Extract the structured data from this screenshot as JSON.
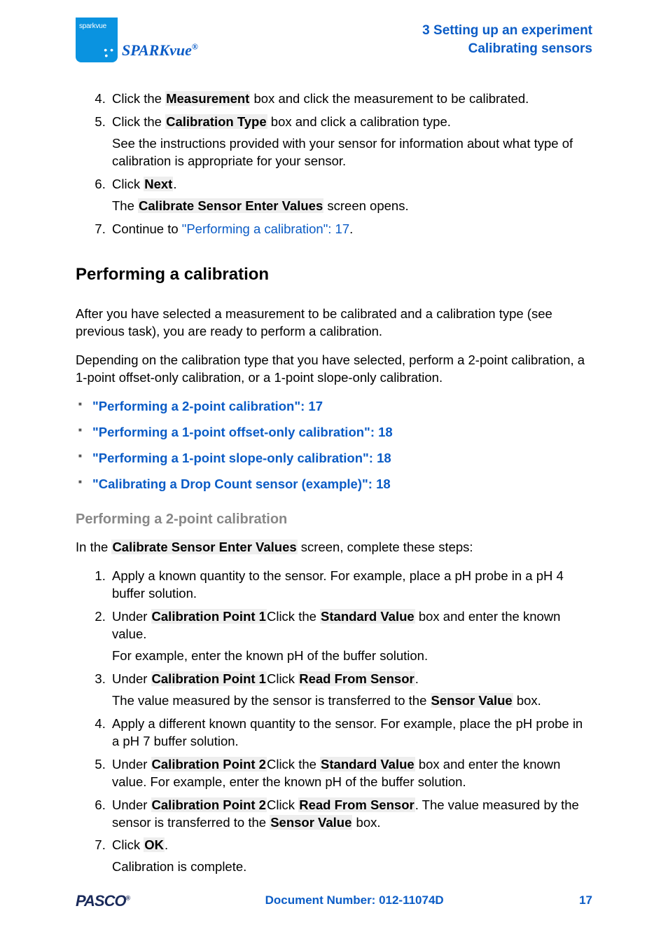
{
  "header": {
    "logo_brand": "sparkvue",
    "product_name": "SPARKvue",
    "trademark": "®",
    "chapter_line": "3   Setting up an experiment",
    "section_line": "Calibrating sensors"
  },
  "steps_top": {
    "start": 4,
    "items": [
      {
        "pre": "Click the ",
        "bold1": "Measurement",
        "post": " box and click the measurement to be calibrated."
      },
      {
        "pre": "Click the ",
        "bold1": "Calibration Type",
        "post": " box and click a calibration type.",
        "para": "See the instructions provided with your sensor for information about what type of calibration is appropriate for your sensor."
      },
      {
        "pre": "Click ",
        "bold1": "Next",
        "post": ".",
        "para_pre": "The ",
        "para_bold": "Calibrate Sensor Enter Values",
        "para_post": " screen opens."
      },
      {
        "pre": "Continue to ",
        "xref": "\"Performing a calibration\":  17",
        "post": "."
      }
    ]
  },
  "section_title": "Performing a calibration",
  "intro1": "After you have selected a measurement to be calibrated and a calibration type (see previous task), you are ready to perform a calibration.",
  "intro2": "Depending on the calibration type that you have selected, perform a 2-point calibration, a 1-point offset-only calibration, or a 1-point slope-only calibration.",
  "links": [
    "\"Performing a 2-point calibration\":  17",
    "\"Performing a 1-point offset-only calibration\":  18",
    "\"Performing a 1-point slope-only calibration\":  18",
    "\"Calibrating a Drop Count sensor (example)\":  18"
  ],
  "subhead": "Performing a 2-point calibration",
  "subintro_pre": "In the ",
  "subintro_bold": "Calibrate Sensor Enter Values",
  "subintro_post": " screen, complete these steps:",
  "steps2": [
    {
      "text": "Apply a known quantity to the sensor. For example, place a pH probe in a pH 4 buffer solution."
    },
    {
      "pre": "Under ",
      "b1": "Calibration Point 1",
      "mid1": "Click the ",
      "b2": "Standard Value",
      "post": " box and enter the known value.",
      "para": "For example, enter the known pH of the buffer solution."
    },
    {
      "pre": "Under ",
      "b1": "Calibration Point 1",
      "mid1": "Click ",
      "b2": "Read From Sensor",
      "post": ".",
      "para_pre": "The value measured by the sensor is transferred to the ",
      "para_bold": "Sensor Value",
      "para_post": " box."
    },
    {
      "text": "Apply a different known quantity to the sensor.  For example, place the pH probe in a pH 7 buffer solution."
    },
    {
      "pre": "Under ",
      "b1": "Calibration Point 2",
      "mid1": "Click the ",
      "b2": "Standard Value",
      "post": " box and enter the known value. For example, enter the known pH of the buffer solution."
    },
    {
      "pre": "Under ",
      "b1": "Calibration Point 2",
      "mid1": "Click ",
      "b2": "Read From Sensor",
      "mid2": ". The value measured by the sensor is transferred to the ",
      "b3": "Sensor Value",
      "post": " box."
    },
    {
      "pre": "Click ",
      "b1": "OK",
      "post": ".",
      "para": "Calibration is complete."
    }
  ],
  "footer": {
    "pasco": "PASCO",
    "docnum": "Document Number: 012-11074D",
    "page": "17"
  }
}
